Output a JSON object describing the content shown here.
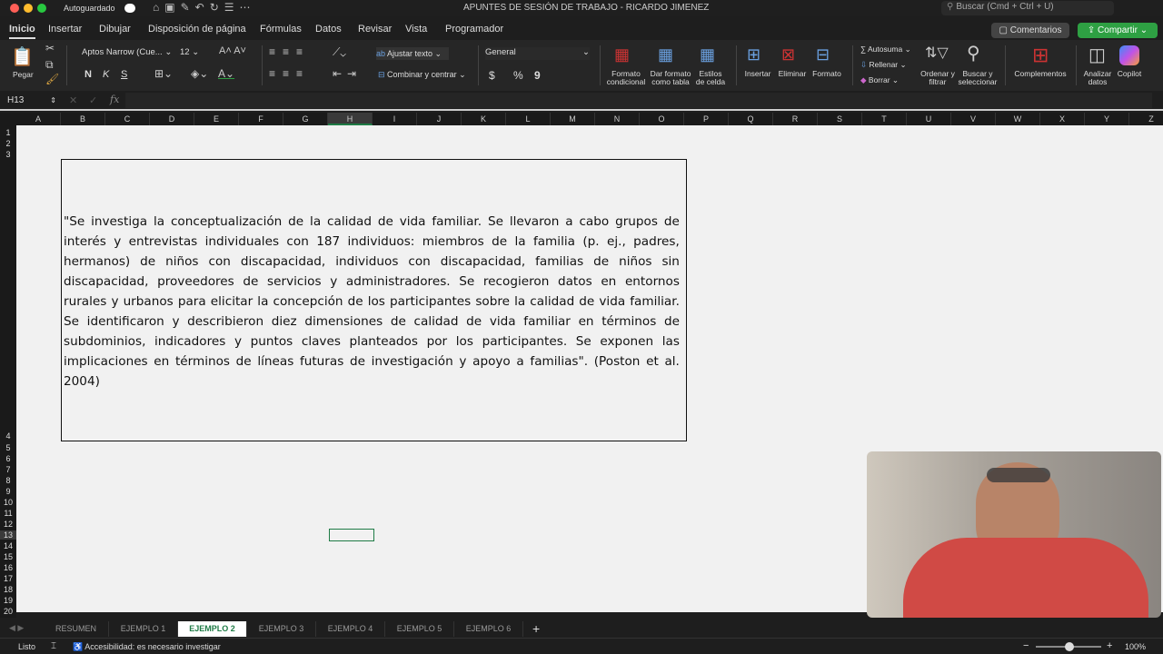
{
  "titlebar": {
    "autosave": "Autoguardado",
    "title": "APUNTES DE SESIÓN DE TRABAJO - RICARDO JIMENEZ",
    "search_placeholder": "Buscar (Cmd + Ctrl + U)"
  },
  "tabs": [
    "Inicio",
    "Insertar",
    "Dibujar",
    "Disposición de página",
    "Fórmulas",
    "Datos",
    "Revisar",
    "Vista",
    "Programador"
  ],
  "buttons": {
    "comments": "Comentarios",
    "share": "Compartir"
  },
  "ribbon": {
    "paste": "Pegar",
    "font": "Aptos Narrow (Cue...",
    "size": "12",
    "bold": "N",
    "italic": "K",
    "underline": "S",
    "wrap": "Ajustar texto",
    "merge": "Combinar y centrar",
    "number_format": "General",
    "currency": "$",
    "percent": "%",
    "comma": "9",
    "cond_format": "Formato condicional",
    "table_format": "Dar formato como tabla",
    "cell_styles": "Estilos de celda",
    "insert": "Insertar",
    "delete": "Eliminar",
    "format": "Formato",
    "autosum": "Autosuma",
    "fill": "Rellenar",
    "clear": "Borrar",
    "sort": "Ordenar y filtrar",
    "find": "Buscar y seleccionar",
    "addins": "Complementos",
    "analyze": "Analizar datos",
    "copilot": "Copilot"
  },
  "formula_bar": {
    "name_box": "H13",
    "fx": "fx",
    "value": ""
  },
  "columns": [
    "A",
    "B",
    "C",
    "D",
    "E",
    "F",
    "G",
    "H",
    "I",
    "J",
    "K",
    "L",
    "M",
    "N",
    "O",
    "P",
    "Q",
    "R",
    "S",
    "T",
    "U",
    "V",
    "W",
    "X",
    "Y",
    "Z"
  ],
  "rows": [
    "1",
    "2",
    "3",
    "4",
    "5",
    "6",
    "7",
    "8",
    "9",
    "10",
    "11",
    "12",
    "13",
    "14",
    "15",
    "16",
    "17",
    "18",
    "19",
    "20"
  ],
  "textbox_lines": [
    "\"Se investiga  la conceptualización de la calidad de vida familiar. Se llevaron a cabo grupos de",
    "interés y entrevistas individuales con 187 individuos: miembros de la familia (p. ej., padres,",
    "hermanos) de niños con discapacidad, individuos con discapacidad, familias de niños sin",
    "discapacidad, proveedores de servicios y administradores. Se recogieron datos en entornos",
    "rurales y urbanos para elicitar la concepción de los participantes sobre la calidad de vida familiar.",
    "Se identificaron y describieron diez dimensiones de calidad de vida familiar en términos de",
    "subdominios, indicadores y puntos claves planteados por los participantes. Se exponen las",
    "implicaciones en términos de líneas futuras de investigación y apoyo a familias\". (Poston et al.",
    "2004)"
  ],
  "sheet_tabs": [
    "RESUMEN",
    "EJEMPLO 1",
    "EJEMPLO 2",
    "EJEMPLO 3",
    "EJEMPLO 4",
    "EJEMPLO 5",
    "EJEMPLO 6"
  ],
  "active_sheet": "EJEMPLO 2",
  "status": {
    "ready": "Listo",
    "accessibility": "Accesibilidad: es necesario investigar",
    "zoom": "100%"
  },
  "colors": {
    "accent": "#1e7b45",
    "share": "#2ea043"
  }
}
